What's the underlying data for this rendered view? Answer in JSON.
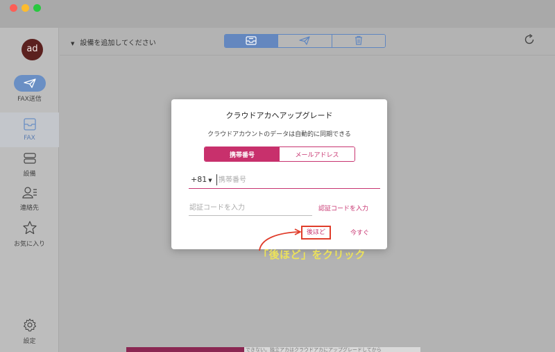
{
  "window": {},
  "sidebar": {
    "avatar_text": "ad",
    "items": [
      {
        "label": "FAX送信",
        "icon": "send-icon"
      },
      {
        "label": "FAX",
        "icon": "fax-tray-icon"
      },
      {
        "label": "設備",
        "icon": "devices-icon"
      },
      {
        "label": "連絡先",
        "icon": "contacts-icon"
      },
      {
        "label": "お気に入り",
        "icon": "star-icon"
      },
      {
        "label": "設定",
        "icon": "gear-icon"
      }
    ]
  },
  "toolbar": {
    "device_add_label": "設備を追加してください",
    "tabs": [
      {
        "icon": "inbox-icon",
        "active": true
      },
      {
        "icon": "send-icon",
        "active": false
      },
      {
        "icon": "trash-icon",
        "active": false
      }
    ],
    "refresh_icon": "refresh-icon"
  },
  "background_text": {
    "bottom_note": "できない。独立アカはクラウドアカにアップグレードしてから"
  },
  "dialog": {
    "title": "クラウドアカヘアップグレード",
    "subtitle": "クラウドアカウントのデータは自動的に同期できる",
    "tabs": [
      {
        "label": "携帯番号",
        "active": true
      },
      {
        "label": "メールアドレス",
        "active": false
      }
    ],
    "country_code": "+81",
    "phone_placeholder": "携帯番号",
    "code_placeholder": "認証コードを入力",
    "code_link": "認証コードを入力",
    "later_button": "後ほど",
    "now_button": "今すぐ"
  },
  "annotation": {
    "text": "「後ほど」をクリック"
  },
  "colors": {
    "accent_pink": "#c8306c",
    "accent_blue": "#6487bf",
    "annotation_yellow": "#ece25a",
    "highlight_red": "#e03c2a"
  }
}
